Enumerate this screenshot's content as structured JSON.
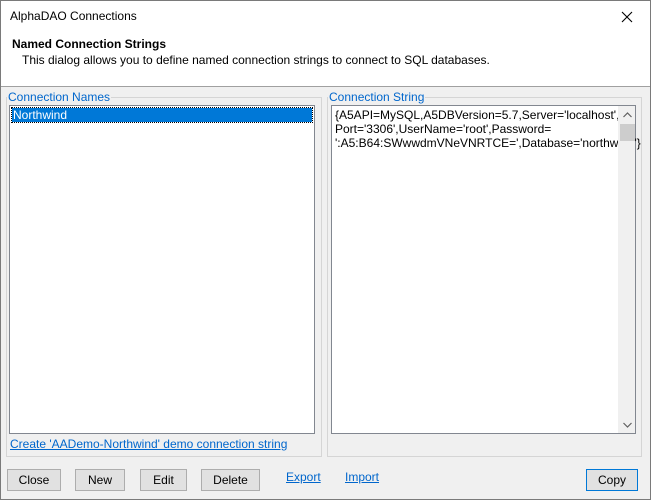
{
  "window": {
    "title": "AlphaDAO Connections"
  },
  "header": {
    "title": "Named Connection Strings",
    "description": "This dialog allows you to define named connection strings to connect to SQL databases."
  },
  "connection_names": {
    "label": "Connection Names",
    "items": [
      {
        "label": "Northwind",
        "selected": true
      }
    ]
  },
  "connection_string": {
    "label": "Connection String",
    "value": "{A5API=MySQL,A5DBVersion=5.7,Server='localhost',\nPort='3306',UserName='root',Password=\n':A5:B64:SWwwdmVNeVNRTCE=',Database='northwind'}"
  },
  "create_demo_link": "Create 'AADemo-Northwind' demo connection string",
  "buttons": {
    "close": "Close",
    "new": "New",
    "edit": "Edit",
    "delete": "Delete",
    "copy": "Copy"
  },
  "links": {
    "export": "Export",
    "import": "Import"
  },
  "colors": {
    "link": "#0066cc",
    "selection": "#0078d7"
  }
}
